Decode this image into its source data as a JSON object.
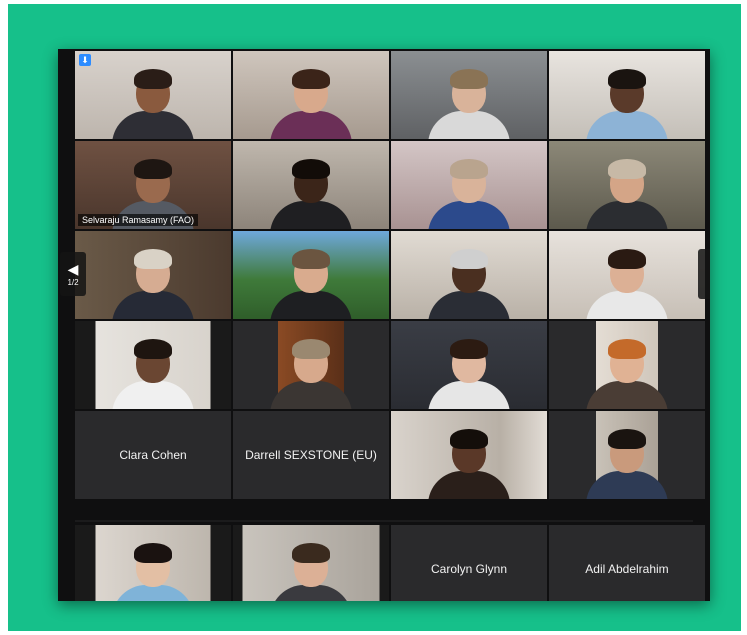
{
  "pagination": {
    "page": "1/2"
  },
  "colors": {
    "background": "#16c08a",
    "window": "#0f0f10",
    "tile": "#2a2a2c",
    "active_speaker": "#c9e24a"
  },
  "participants": [
    {
      "name": "",
      "video": true,
      "self": true
    },
    {
      "name": "",
      "video": true
    },
    {
      "name": "",
      "video": true
    },
    {
      "name": "",
      "video": true
    },
    {
      "name": "Selvaraju Ramasamy (FAO)",
      "video": true,
      "speaking": true
    },
    {
      "name": "",
      "video": true
    },
    {
      "name": "",
      "video": true
    },
    {
      "name": "",
      "video": true
    },
    {
      "name": "",
      "video": true
    },
    {
      "name": "",
      "video": true,
      "speaking": true
    },
    {
      "name": "",
      "video": true
    },
    {
      "name": "",
      "video": true
    },
    {
      "name": "",
      "video": true
    },
    {
      "name": "",
      "video": true
    },
    {
      "name": "",
      "video": true
    },
    {
      "name": "",
      "video": true
    },
    {
      "name": "Clara Cohen",
      "video": false
    },
    {
      "name": "Darrell SEXSTONE (EU)",
      "video": false
    },
    {
      "name": "",
      "video": true
    },
    {
      "name": "",
      "video": true
    },
    {
      "name": "",
      "video": true
    },
    {
      "name": "",
      "video": true
    },
    {
      "name": "Carolyn Glynn",
      "video": false
    },
    {
      "name": "Adil Abdelrahim",
      "video": false
    }
  ]
}
